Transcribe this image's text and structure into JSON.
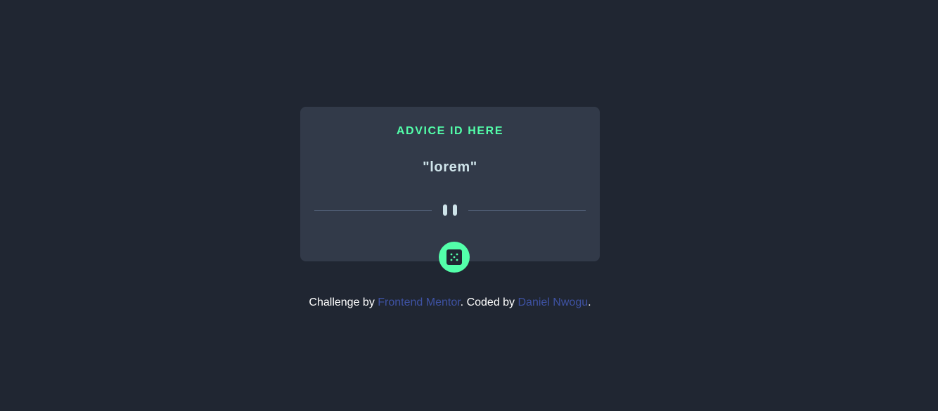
{
  "card": {
    "advice_id": "ADVICE ID HERE",
    "advice_text": "\"lorem\""
  },
  "icons": {
    "divider": "pause-divider-icon",
    "dice": "dice-icon"
  },
  "footer": {
    "prefix": "Challenge by ",
    "link1": "Frontend Mentor",
    "middle": ". Coded by ",
    "link2": "Daniel Nwogu",
    "suffix": "."
  },
  "colors": {
    "background": "#202632",
    "card": "#323a49",
    "accent": "#53ffaa",
    "text": "#cee3e9",
    "link": "#3e52a3"
  }
}
